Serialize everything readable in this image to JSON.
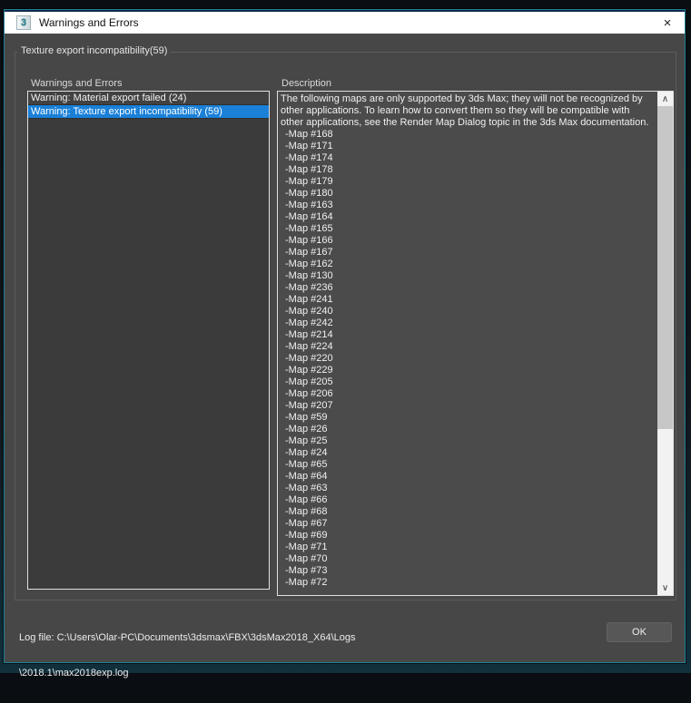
{
  "window": {
    "title": "Warnings and Errors",
    "group_title": "Texture export incompatibility(59)",
    "icon_text": "3"
  },
  "icons": {
    "close": "×",
    "scroll_up": "∧",
    "scroll_down": "∨"
  },
  "warnings_panel": {
    "label": "Warnings and Errors",
    "items": [
      {
        "label": "Warning: Material export failed (24)",
        "selected": false
      },
      {
        "label": "Warning: Texture export incompatibility (59)",
        "selected": true
      }
    ]
  },
  "description_panel": {
    "label": "Description",
    "intro": "The following maps are only supported by 3ds Max; they will not be recognized by other applications. To learn how to convert them so they will be compatible with other applications, see the Render Map Dialog topic in the 3ds Max documentation.",
    "maps": [
      "-Map #168",
      "-Map #171",
      "-Map #174",
      "-Map #178",
      "-Map #179",
      "-Map #180",
      "-Map #163",
      "-Map #164",
      "-Map #165",
      "-Map #166",
      "-Map #167",
      "-Map #162",
      "-Map #130",
      "-Map #236",
      "-Map #241",
      "-Map #240",
      "-Map #242",
      "-Map #214",
      "-Map #224",
      "-Map #220",
      "-Map #229",
      "-Map #205",
      "-Map #206",
      "-Map #207",
      "-Map #59",
      "-Map #26",
      "-Map #25",
      "-Map #24",
      "-Map #65",
      "-Map #64",
      "-Map #63",
      "-Map #66",
      "-Map #68",
      "-Map #67",
      "-Map #69",
      "-Map #71",
      "-Map #70",
      "-Map #73",
      "-Map #72"
    ]
  },
  "footer": {
    "log_line1": "Log file: C:\\Users\\Olar-PC\\Documents\\3dsmax\\FBX\\3dsMax2018_X64\\Logs",
    "log_line2": "\\2018.1\\max2018exp.log",
    "ok_label": "OK"
  },
  "colors": {
    "selection_blue": "#1a80d8",
    "accent_border": "#1d8096",
    "titlebar_bg": "#ffffff",
    "dialog_bg": "#474747"
  }
}
